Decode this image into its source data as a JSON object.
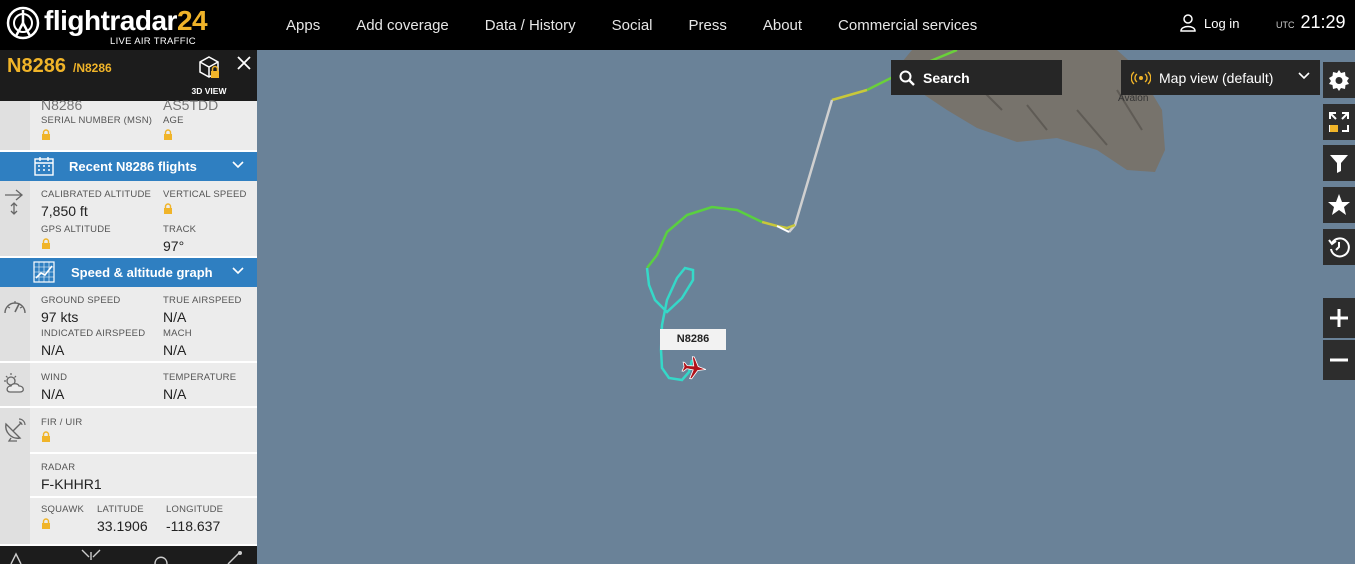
{
  "header": {
    "logo_main": "flightradar",
    "logo_num": "24",
    "logo_sub": "LIVE AIR TRAFFIC",
    "nav": [
      "Apps",
      "Add coverage",
      "Data / History",
      "Social",
      "Press",
      "About",
      "Commercial services"
    ],
    "login_label": "Log in",
    "utc_label": "UTC",
    "time": "21:29"
  },
  "panel": {
    "callsign": "N8286",
    "callsign_sub": "/N8286",
    "view3d_label": "3D VIEW",
    "aircraft_partial": {
      "reg": "N8286",
      "type": "AS5TDD"
    },
    "serial_label": "SERIAL NUMBER (MSN)",
    "age_label": "AGE",
    "recent_flights_label": "Recent N8286 flights",
    "calibrated_altitude_label": "CALIBRATED ALTITUDE",
    "calibrated_altitude": "7,850 ft",
    "vertical_speed_label": "VERTICAL SPEED",
    "gps_altitude_label": "GPS ALTITUDE",
    "track_label": "TRACK",
    "track": "97°",
    "speed_graph_label": "Speed & altitude graph",
    "ground_speed_label": "GROUND SPEED",
    "ground_speed": "97 kts",
    "true_airspeed_label": "TRUE AIRSPEED",
    "true_airspeed": "N/A",
    "indicated_airspeed_label": "INDICATED AIRSPEED",
    "indicated_airspeed": "N/A",
    "mach_label": "MACH",
    "mach": "N/A",
    "wind_label": "WIND",
    "wind": "N/A",
    "temperature_label": "TEMPERATURE",
    "temperature": "N/A",
    "fir_label": "FIR / UIR",
    "radar_label": "RADAR",
    "radar": "F-KHHR1",
    "squawk_label": "SQUAWK",
    "latitude_label": "LATITUDE",
    "latitude": "33.1906",
    "longitude_label": "LONGITUDE",
    "longitude": "-118.637"
  },
  "map": {
    "search_label": "Search",
    "map_view_label": "Map view (default)",
    "aircraft_label": "N8286",
    "place_label": "Avalon"
  },
  "colors": {
    "accent": "#f0b429",
    "section_blue": "#2f7fc1",
    "water": "#6a8298",
    "aircraft": "#b0121a"
  }
}
